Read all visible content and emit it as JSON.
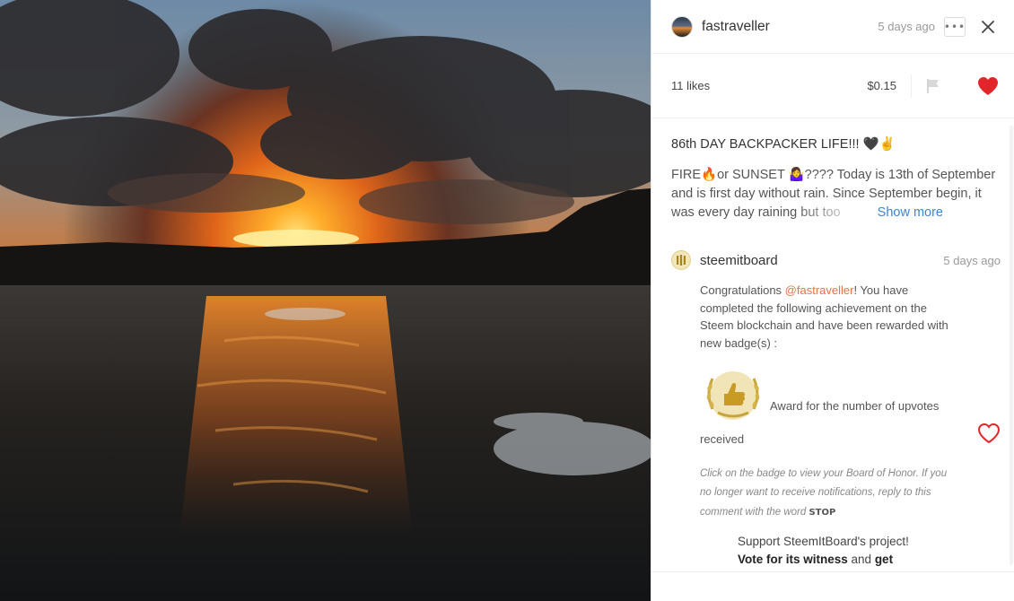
{
  "post": {
    "author": "fastraveller",
    "time": "5 days ago",
    "more_label": "•••",
    "likes": "11 likes",
    "payout": "$0.15",
    "title": "86th DAY BACKPACKER LIFE!!! 🖤✌",
    "body": "FIRE🔥or SUNSET 🤷‍♀️???? Today is 13th of September and is first day without rain. Since September begin, it was every day raining but too",
    "show_more": "Show more"
  },
  "comment": {
    "author": "steemitboard",
    "time": "5 days ago",
    "text_before": "Congratulations ",
    "mention": "@fastraveller",
    "text_after": "! You have completed the following achievement on the Steem blockchain and have been rewarded with new badge(s) :",
    "badge_text_1": "Award for the number of upvotes",
    "badge_text_2": "received",
    "notice": "Click on the badge to view your Board of Honor. If you no longer want to receive notifications, reply to this comment with the word",
    "stop": "STOP",
    "support_line": "Support SteemItBoard's project!",
    "vote_bold": "Vote for its witness",
    "vote_and": " and ",
    "vote_get": "get"
  },
  "colors": {
    "heart_red": "#e0262b",
    "link_blue": "#3b86d6",
    "mention_orange": "#e0744a"
  },
  "icons": [
    "more-icon",
    "close-icon",
    "flag-icon",
    "heart-icon",
    "heart-outline-icon",
    "steemitboard-logo-icon",
    "badge-icon"
  ]
}
